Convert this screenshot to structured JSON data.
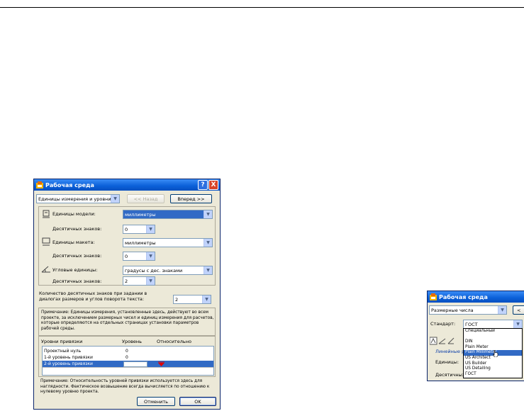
{
  "dialog1": {
    "title": "Рабочая среда",
    "section_combo": "Единицы измерения и уровни",
    "back_button": "<< Назад",
    "forward_button": "Вперед >>",
    "model_units": {
      "label": "Единицы модели:",
      "value": "миллиметры",
      "decimals_label": "Десятичных знаков:",
      "decimals": "0"
    },
    "layout_units": {
      "label": "Единицы макета:",
      "value": "миллиметры",
      "decimals_label": "Десятичных знаков:",
      "decimals": "0"
    },
    "angle_units": {
      "label": "Угловые единицы:",
      "value": "градусы с дес. знаками",
      "decimals_label": "Десятичных знаков:",
      "decimals": "2"
    },
    "dim_decimals_label": "Количество десятичных знаков при задании в диалогах размеров и углов поворота текста:",
    "dim_decimals": "2",
    "note1": "Примечание: Единицы измерения, установленные здесь, действуют во всем проекте, за исключением размерных чисел и единиц измерения для расчетов, которые определяются на отдельных страницах установки параметров рабочей среды.",
    "levels_header": {
      "name": "Уровни привязки",
      "level": "Уровень",
      "relative": "Относительно"
    },
    "levels": [
      {
        "name": "Проектный нуль",
        "value": "0"
      },
      {
        "name": "1-й уровень привязки",
        "value": "0"
      },
      {
        "name": "2-й уровень привязки",
        "value": ""
      }
    ],
    "note2": "Примечание: Относительность уровней привязки используется здесь для наглядности. Фактическое возвышение всегда вычисляется по отношению к нулевому уровню проекта.",
    "cancel_button": "Отменить",
    "ok_button": "OK",
    "help_button": "?",
    "close_button": "X"
  },
  "dialog2": {
    "title": "Рабочая среда",
    "section_combo": "Размерные числа",
    "back_button_partial": "<",
    "standard_label": "Стандарт:",
    "standard_value": "ГОСТ",
    "options": [
      "Специальный",
      "",
      "DIN",
      "Plain Meter",
      "Plain Millimeter",
      "US Architect",
      "US Builder",
      "US Detailing",
      "ГОСТ"
    ],
    "highlighted_option": "Plain Millimeter",
    "linear_label_partial": "Линейные раз",
    "units_label_partial": "Единицы:",
    "decimals_label_partial": "Десятичных з"
  }
}
